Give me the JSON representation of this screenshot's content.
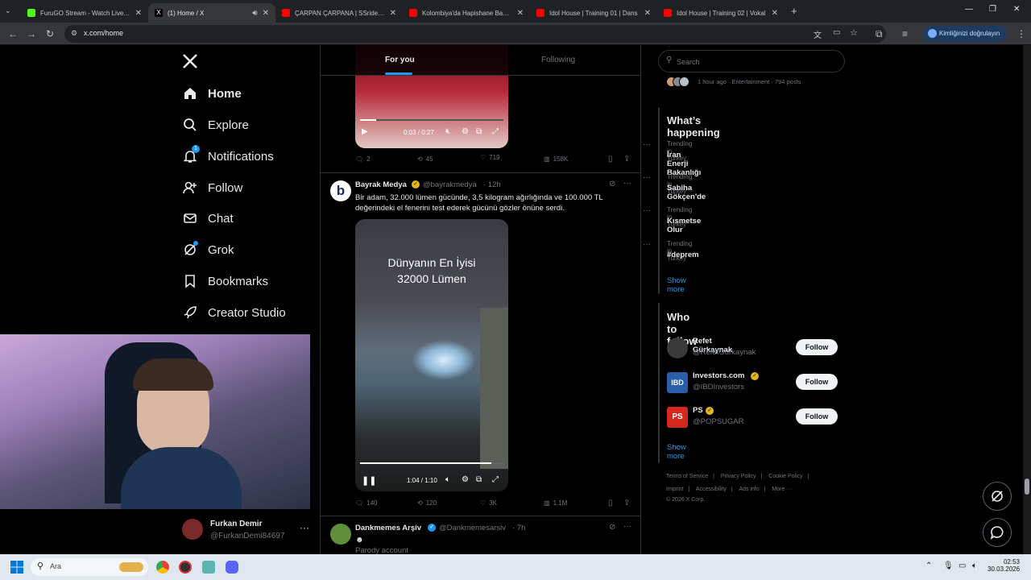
{
  "browser": {
    "tabs": [
      {
        "title": "FuruGO Stream - Watch Live on",
        "color": "#53fc18",
        "active": false
      },
      {
        "title": "(1) Home / X",
        "color": "#ffffff",
        "active": true
      },
      {
        "title": "ÇARPAN ÇARPANA | SSriders | K",
        "color": "#ff0000",
        "active": false
      },
      {
        "title": "Kolombiya'da Hapishane Baskın",
        "color": "#ff0000",
        "active": false
      },
      {
        "title": "Idol House | Training 01 | Dans",
        "color": "#ff0000",
        "active": false
      },
      {
        "title": "Idol House | Training 02 | Vokal",
        "color": "#ff0000",
        "active": false
      }
    ],
    "new_tab_glyph": "+",
    "url": "x.com/home",
    "verify_label": "Kimliğinizi doğrulayın"
  },
  "nav": {
    "logo": "X",
    "items": [
      {
        "label": "Home",
        "icon": "home-icon"
      },
      {
        "label": "Explore",
        "icon": "search-icon"
      },
      {
        "label": "Notifications",
        "icon": "bell-icon",
        "badge": "1"
      },
      {
        "label": "Follow",
        "icon": "person-plus-icon"
      },
      {
        "label": "Chat",
        "icon": "mail-icon"
      },
      {
        "label": "Grok",
        "icon": "grok-icon"
      },
      {
        "label": "Bookmarks",
        "icon": "bookmark-icon"
      },
      {
        "label": "Creator Studio",
        "icon": "rocket-icon"
      }
    ],
    "account": {
      "name": "Furkan Demir",
      "handle": "@FurkanDemi84697"
    }
  },
  "feed": {
    "tabs": [
      "For you",
      "Following"
    ],
    "post1": {
      "video_time": "0:03 / 0:27",
      "stats": {
        "replies": "2",
        "reposts": "45",
        "likes": "719",
        "views": "158K"
      }
    },
    "post2": {
      "author": "Bayrak Medya",
      "handle": "@bayrakmedya",
      "time": "· 12h",
      "text": "Bir adam, 32.000 lümen gücünde, 3,5 kilogram ağırlığında ve 100.000 TL değerindeki el fenerini test ederek gücünü gözler önüne serdi.",
      "video_caption_line1": "Dünyanın En İyisi",
      "video_caption_line2": "32000 Lümen",
      "video_time": "1:04 / 1:10",
      "stats": {
        "replies": "140",
        "reposts": "120",
        "likes": "3K",
        "views": "1.1M"
      }
    },
    "post3": {
      "author": "Dankmemes Arşiv",
      "handle": "@Dankmemesarsiv",
      "time": "· 7h",
      "text": "Parody account"
    }
  },
  "sidebar": {
    "search_placeholder": "Search",
    "news_meta": "1 hour ago · Entertainment · 794 posts",
    "happening_title": "What’s happening",
    "trends": [
      {
        "meta": "Trending in Turkey",
        "name": "İran Enerji Bakanlığı"
      },
      {
        "meta": "Trending in Turkey",
        "name": "Sabiha Gökçen'de"
      },
      {
        "meta": "Trending in Turkey",
        "name": "Kısmetse Olur"
      },
      {
        "meta": "Trending in Turkey",
        "name": "#deprem"
      }
    ],
    "show_more": "Show more",
    "who_title": "Who to follow",
    "follow_label": "Follow",
    "suggestions": [
      {
        "name": "Refet Gürkaynak",
        "handle": "@RefetGurkaynak",
        "avatar_color": "#3a3a3a"
      },
      {
        "name": "Investors.com",
        "handle": "@IBDInvestors",
        "avatar_color": "#2a5ea8",
        "avatar_text": "IBD"
      },
      {
        "name": "PS",
        "handle": "@POPSUGAR",
        "avatar_color": "#d4281f",
        "avatar_text": "PS"
      }
    ],
    "footer": [
      "Terms of Service",
      "Privacy Policy",
      "Cookie Policy",
      "Imprint",
      "Accessibility",
      "Ads info",
      "More ···",
      "© 2026 X Corp."
    ]
  },
  "taskbar": {
    "search_placeholder": "Ara",
    "time": "02:53",
    "date": "30.03.2026"
  },
  "colors": {
    "accent": "#1d9bf0",
    "verified": "#e2b719"
  }
}
